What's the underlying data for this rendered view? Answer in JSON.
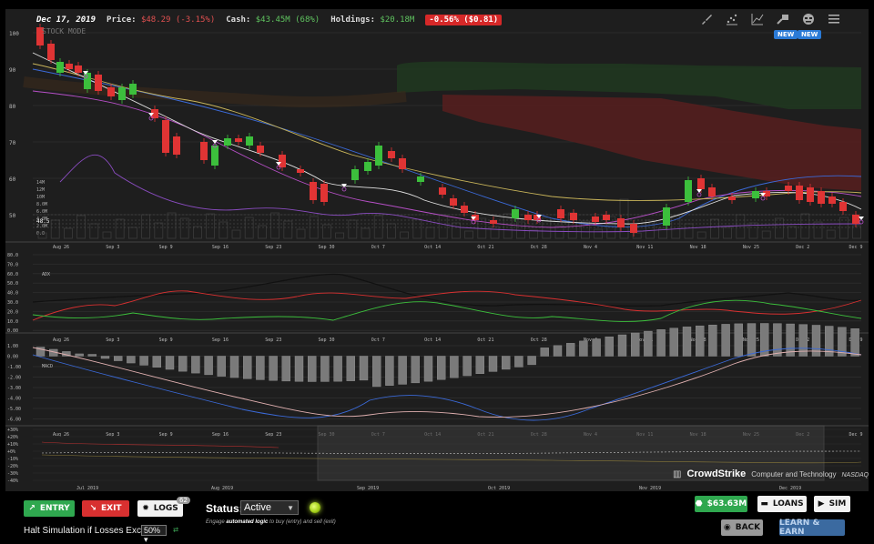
{
  "header": {
    "date": "Dec 17, 2019",
    "price_label": "Price:",
    "price_value": "$48.29 (-3.15%)",
    "cash_label": "Cash:",
    "cash_value": "$43.45M (68%)",
    "holdings_label": "Holdings:",
    "holdings_value": "$20.18M",
    "change_badge": "-0.56% ($0.81)",
    "mode": "STOCK MODE"
  },
  "toolbar": {
    "icons": [
      "brush-icon",
      "scatter-icon",
      "line-chart-icon",
      "plug-icon",
      "mask-icon",
      "menu-icon"
    ],
    "new_label": "NEW"
  },
  "price_axis": {
    "ticks": [
      "100",
      "90",
      "80",
      "70",
      "60",
      "50"
    ],
    "price_marker": "48.5",
    "volume_ticks": [
      "14M",
      "12M",
      "10M",
      "8.0M",
      "6.0M",
      "4.0M",
      "2.0M",
      "0.0"
    ]
  },
  "date_ticks": [
    "Aug 26",
    "Sep 3",
    "Sep 9",
    "Sep 16",
    "Sep 23",
    "Sep 30",
    "Oct 7",
    "Oct 14",
    "Oct 21",
    "Oct 28",
    "Nov 4",
    "Nov 11",
    "Nov 18",
    "Nov 25",
    "Dec 2",
    "Dec 9"
  ],
  "adx": {
    "label": "ADX",
    "ticks": [
      "80.0",
      "70.0",
      "60.0",
      "50.0",
      "40.0",
      "30.0",
      "20.0",
      "10.0",
      "0.00"
    ]
  },
  "macd": {
    "label": "MACD",
    "ticks": [
      "1.00",
      "0.00",
      "-1.00",
      "-2.00",
      "-3.00",
      "-4.00",
      "-5.00",
      "-6.00"
    ]
  },
  "overview": {
    "ticks": [
      "+30%",
      "+20%",
      "+10%",
      "+0%",
      "-10%",
      "-20%",
      "-30%",
      "-40%"
    ],
    "months": [
      "Jul 2019",
      "Aug 2019",
      "Sep 2019",
      "Oct 2019",
      "Nov 2019",
      "Dec 2019"
    ]
  },
  "company": {
    "name": "CrowdStrike",
    "sector": "Computer and Technology",
    "exchange": "NASDAQ"
  },
  "controls": {
    "entry_label": "ENTRY",
    "exit_label": "EXIT",
    "logs_label": "LOGS",
    "logs_count": "62",
    "status_label": "Status:",
    "status_value": "Active",
    "help_prefix": "Engage ",
    "help_bold": "automated logic",
    "help_suffix": " to buy (entry) and sell (exit)",
    "halt_label": "Halt Simulation if Losses Exceed",
    "halt_value": "50%",
    "cash_button": "$63.63M",
    "loans_button": "LOANS",
    "sim_button": "SIM",
    "back_button": "BACK",
    "learn_button": "LEARN & EARN"
  },
  "colors": {
    "up": "#3cbf3c",
    "down": "#e03434",
    "accent_blue": "#2a7ad6"
  }
}
